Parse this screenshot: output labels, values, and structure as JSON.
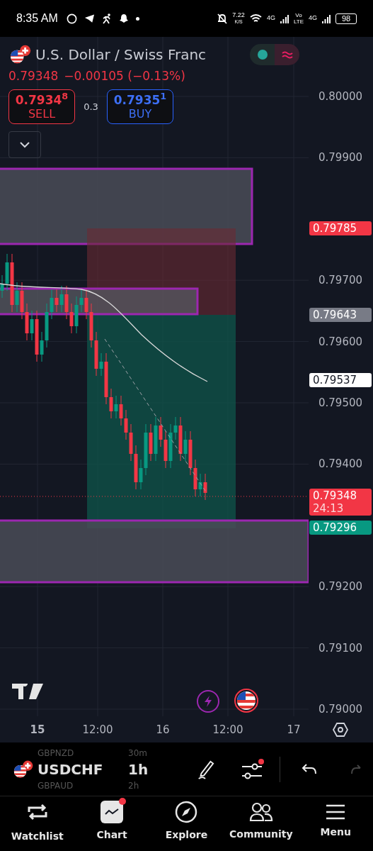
{
  "status_bar": {
    "time": "8:35 AM",
    "speed": "7.22",
    "speed_unit": "K/S",
    "net_1": "4G",
    "volte_top": "Vo",
    "volte_bottom": "LTE",
    "net_2": "4G",
    "battery": "98"
  },
  "header": {
    "title": "U.S. Dollar / Swiss Franc",
    "market_open": true,
    "price": "0.79348",
    "change": "−0.00105 (−0.13%)",
    "sell": {
      "price": "0.7934$^{8}$",
      "label": "SELL"
    },
    "spread": "0.3",
    "buy": {
      "price": "0.7935$^{1}$",
      "label": "BUY"
    }
  },
  "price_axis": {
    "ticks": [
      "0.80000",
      "0.79900",
      "0.79700",
      "0.79600",
      "0.79500",
      "0.79400",
      "0.79200",
      "0.79100",
      "0.79000"
    ],
    "markers": [
      {
        "value": "0.79785",
        "color": "#f23645"
      },
      {
        "value": "0.79643",
        "color": "#787b86"
      },
      {
        "value": "0.79537",
        "color": "#ffffff"
      },
      {
        "value": "0.79348",
        "color": "#f23645",
        "countdown": "24:13"
      },
      {
        "value": "0.79296",
        "color": "#089981"
      }
    ]
  },
  "time_axis": [
    {
      "label": "15",
      "bold": true
    },
    {
      "label": "12:00",
      "bold": false
    },
    {
      "label": "16",
      "bold": false
    },
    {
      "label": "12:00",
      "bold": false
    },
    {
      "label": "17",
      "bold": false
    }
  ],
  "toolbar": {
    "symbol": "USDCHF",
    "interval": "1h",
    "prev_symbol": "GBPNZD",
    "prev_interval": "30m",
    "next_symbol": "GBPAUD",
    "next_interval": "2h",
    "indicator_alert": true
  },
  "nav": [
    {
      "kind": "watchlist",
      "label": "Watchlist"
    },
    {
      "kind": "chart",
      "label": "Chart"
    },
    {
      "kind": "explore",
      "label": "Explore"
    },
    {
      "kind": "community",
      "label": "Community"
    },
    {
      "kind": "menu",
      "label": "Menu"
    }
  ]
}
